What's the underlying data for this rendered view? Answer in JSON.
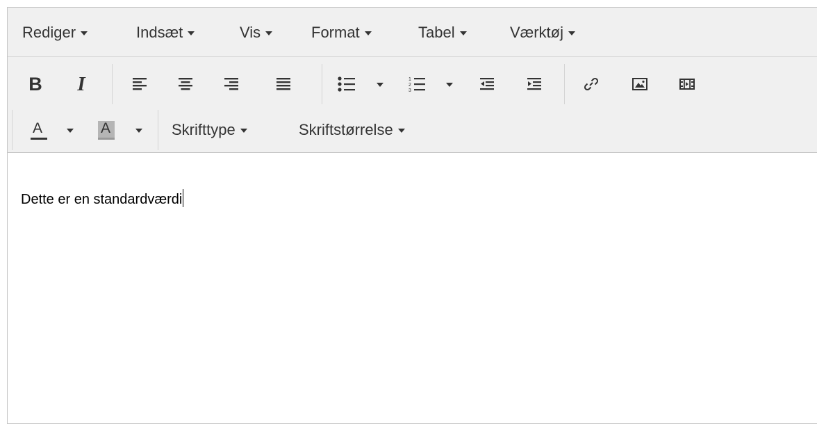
{
  "menubar": {
    "items": [
      {
        "label": "Rediger"
      },
      {
        "label": "Indsæt"
      },
      {
        "label": "Vis"
      },
      {
        "label": "Format"
      },
      {
        "label": "Tabel"
      },
      {
        "label": "Værktøj"
      }
    ]
  },
  "toolbar": {
    "bold_label": "B",
    "italic_label": "I",
    "font_color_label": "A",
    "bg_color_label": "A",
    "font_family_label": "Skrifttype",
    "font_size_label": "Skriftstørrelse"
  },
  "content": {
    "text": "Dette er en standardværdi"
  },
  "colors": {
    "toolbar_bg": "#f0f0f0",
    "border": "#c5c5c5",
    "icon": "#333333",
    "text": "#000000"
  }
}
